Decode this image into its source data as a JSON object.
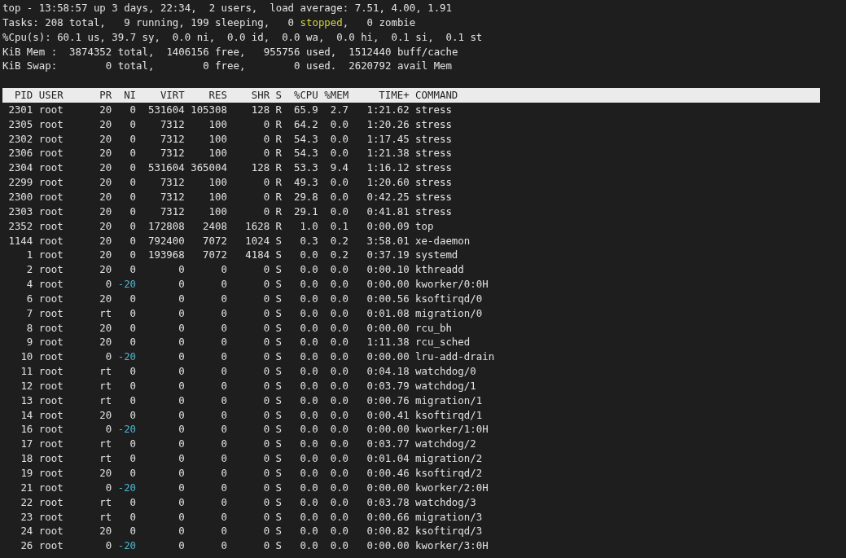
{
  "summary": [
    [
      {
        "text": "top - 13:58:57 up 3 days, 22:34,  2 users,  load average: 7.51, 4.00, 1.91",
        "highlighted": false
      }
    ],
    [
      {
        "text": "Tasks: 208 total,   9 running, 199 sleeping,   0 ",
        "highlighted": false
      },
      {
        "text": "stopped",
        "highlighted": true
      },
      {
        "text": ",   0 zombie",
        "highlighted": false
      }
    ],
    [
      {
        "text": "%Cpu(s): 60.1 us, 39.7 sy,  0.0 ni,  0.0 id,  0.0 wa,  0.0 hi,  0.1 si,  0.1 st",
        "highlighted": false
      }
    ],
    [
      {
        "text": "KiB Mem :  3874352 total,  1406156 free,   955756 used,  1512440 buff/cache",
        "highlighted": false
      }
    ],
    [
      {
        "text": "KiB Swap:        0 total,        0 free,        0 used.  2620792 avail Mem",
        "highlighted": false
      }
    ]
  ],
  "table": {
    "columns": [
      "PID",
      "USER",
      "PR",
      "NI",
      "VIRT",
      "RES",
      "SHR",
      "S",
      "%CPU",
      "%MEM",
      "TIME+",
      "COMMAND"
    ],
    "rows": [
      {
        "cells": [
          "2301",
          "root",
          "20",
          "0",
          "531604",
          "105308",
          "128",
          "R",
          "65.9",
          "2.7",
          "1:21.62",
          "stress"
        ],
        "ni_highlighted": false
      },
      {
        "cells": [
          "2305",
          "root",
          "20",
          "0",
          "7312",
          "100",
          "0",
          "R",
          "64.2",
          "0.0",
          "1:20.26",
          "stress"
        ],
        "ni_highlighted": false
      },
      {
        "cells": [
          "2302",
          "root",
          "20",
          "0",
          "7312",
          "100",
          "0",
          "R",
          "54.3",
          "0.0",
          "1:17.45",
          "stress"
        ],
        "ni_highlighted": false
      },
      {
        "cells": [
          "2306",
          "root",
          "20",
          "0",
          "7312",
          "100",
          "0",
          "R",
          "54.3",
          "0.0",
          "1:21.38",
          "stress"
        ],
        "ni_highlighted": false
      },
      {
        "cells": [
          "2304",
          "root",
          "20",
          "0",
          "531604",
          "365004",
          "128",
          "R",
          "53.3",
          "9.4",
          "1:16.12",
          "stress"
        ],
        "ni_highlighted": false
      },
      {
        "cells": [
          "2299",
          "root",
          "20",
          "0",
          "7312",
          "100",
          "0",
          "R",
          "49.3",
          "0.0",
          "1:20.60",
          "stress"
        ],
        "ni_highlighted": false
      },
      {
        "cells": [
          "2300",
          "root",
          "20",
          "0",
          "7312",
          "100",
          "0",
          "R",
          "29.8",
          "0.0",
          "0:42.25",
          "stress"
        ],
        "ni_highlighted": false
      },
      {
        "cells": [
          "2303",
          "root",
          "20",
          "0",
          "7312",
          "100",
          "0",
          "R",
          "29.1",
          "0.0",
          "0:41.81",
          "stress"
        ],
        "ni_highlighted": false
      },
      {
        "cells": [
          "2352",
          "root",
          "20",
          "0",
          "172808",
          "2408",
          "1628",
          "R",
          "1.0",
          "0.1",
          "0:00.09",
          "top"
        ],
        "ni_highlighted": false
      },
      {
        "cells": [
          "1144",
          "root",
          "20",
          "0",
          "792400",
          "7072",
          "1024",
          "S",
          "0.3",
          "0.2",
          "3:58.01",
          "xe-daemon"
        ],
        "ni_highlighted": false
      },
      {
        "cells": [
          "1",
          "root",
          "20",
          "0",
          "193968",
          "7072",
          "4184",
          "S",
          "0.0",
          "0.2",
          "0:37.19",
          "systemd"
        ],
        "ni_highlighted": false
      },
      {
        "cells": [
          "2",
          "root",
          "20",
          "0",
          "0",
          "0",
          "0",
          "S",
          "0.0",
          "0.0",
          "0:00.10",
          "kthreadd"
        ],
        "ni_highlighted": false
      },
      {
        "cells": [
          "4",
          "root",
          "0",
          "-20",
          "0",
          "0",
          "0",
          "S",
          "0.0",
          "0.0",
          "0:00.00",
          "kworker/0:0H"
        ],
        "ni_highlighted": true
      },
      {
        "cells": [
          "6",
          "root",
          "20",
          "0",
          "0",
          "0",
          "0",
          "S",
          "0.0",
          "0.0",
          "0:00.56",
          "ksoftirqd/0"
        ],
        "ni_highlighted": false
      },
      {
        "cells": [
          "7",
          "root",
          "rt",
          "0",
          "0",
          "0",
          "0",
          "S",
          "0.0",
          "0.0",
          "0:01.08",
          "migration/0"
        ],
        "ni_highlighted": false
      },
      {
        "cells": [
          "8",
          "root",
          "20",
          "0",
          "0",
          "0",
          "0",
          "S",
          "0.0",
          "0.0",
          "0:00.00",
          "rcu_bh"
        ],
        "ni_highlighted": false
      },
      {
        "cells": [
          "9",
          "root",
          "20",
          "0",
          "0",
          "0",
          "0",
          "S",
          "0.0",
          "0.0",
          "1:11.38",
          "rcu_sched"
        ],
        "ni_highlighted": false
      },
      {
        "cells": [
          "10",
          "root",
          "0",
          "-20",
          "0",
          "0",
          "0",
          "S",
          "0.0",
          "0.0",
          "0:00.00",
          "lru-add-drain"
        ],
        "ni_highlighted": true
      },
      {
        "cells": [
          "11",
          "root",
          "rt",
          "0",
          "0",
          "0",
          "0",
          "S",
          "0.0",
          "0.0",
          "0:04.18",
          "watchdog/0"
        ],
        "ni_highlighted": false
      },
      {
        "cells": [
          "12",
          "root",
          "rt",
          "0",
          "0",
          "0",
          "0",
          "S",
          "0.0",
          "0.0",
          "0:03.79",
          "watchdog/1"
        ],
        "ni_highlighted": false
      },
      {
        "cells": [
          "13",
          "root",
          "rt",
          "0",
          "0",
          "0",
          "0",
          "S",
          "0.0",
          "0.0",
          "0:00.76",
          "migration/1"
        ],
        "ni_highlighted": false
      },
      {
        "cells": [
          "14",
          "root",
          "20",
          "0",
          "0",
          "0",
          "0",
          "S",
          "0.0",
          "0.0",
          "0:00.41",
          "ksoftirqd/1"
        ],
        "ni_highlighted": false
      },
      {
        "cells": [
          "16",
          "root",
          "0",
          "-20",
          "0",
          "0",
          "0",
          "S",
          "0.0",
          "0.0",
          "0:00.00",
          "kworker/1:0H"
        ],
        "ni_highlighted": true
      },
      {
        "cells": [
          "17",
          "root",
          "rt",
          "0",
          "0",
          "0",
          "0",
          "S",
          "0.0",
          "0.0",
          "0:03.77",
          "watchdog/2"
        ],
        "ni_highlighted": false
      },
      {
        "cells": [
          "18",
          "root",
          "rt",
          "0",
          "0",
          "0",
          "0",
          "S",
          "0.0",
          "0.0",
          "0:01.04",
          "migration/2"
        ],
        "ni_highlighted": false
      },
      {
        "cells": [
          "19",
          "root",
          "20",
          "0",
          "0",
          "0",
          "0",
          "S",
          "0.0",
          "0.0",
          "0:00.46",
          "ksoftirqd/2"
        ],
        "ni_highlighted": false
      },
      {
        "cells": [
          "21",
          "root",
          "0",
          "-20",
          "0",
          "0",
          "0",
          "S",
          "0.0",
          "0.0",
          "0:00.00",
          "kworker/2:0H"
        ],
        "ni_highlighted": true
      },
      {
        "cells": [
          "22",
          "root",
          "rt",
          "0",
          "0",
          "0",
          "0",
          "S",
          "0.0",
          "0.0",
          "0:03.78",
          "watchdog/3"
        ],
        "ni_highlighted": false
      },
      {
        "cells": [
          "23",
          "root",
          "rt",
          "0",
          "0",
          "0",
          "0",
          "S",
          "0.0",
          "0.0",
          "0:00.66",
          "migration/3"
        ],
        "ni_highlighted": false
      },
      {
        "cells": [
          "24",
          "root",
          "20",
          "0",
          "0",
          "0",
          "0",
          "S",
          "0.0",
          "0.0",
          "0:00.82",
          "ksoftirqd/3"
        ],
        "ni_highlighted": false
      },
      {
        "cells": [
          "26",
          "root",
          "0",
          "-20",
          "0",
          "0",
          "0",
          "S",
          "0.0",
          "0.0",
          "0:00.00",
          "kworker/3:0H"
        ],
        "ni_highlighted": true
      }
    ]
  }
}
